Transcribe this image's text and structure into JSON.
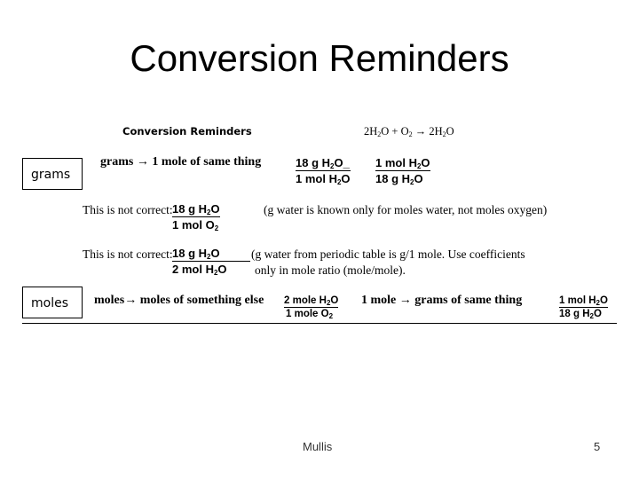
{
  "slide": {
    "title": "Conversion Reminders",
    "footer_author": "Mullis",
    "page_number": "5"
  },
  "content": {
    "heading": "Conversion Reminders",
    "equation": {
      "left_coef": "2H",
      "left_sub": "2",
      "left_rest": "O + O",
      "o2_sub": "2",
      "arrow": "→",
      "right_coef": "2H",
      "right_sub": "2",
      "right_rest": "O"
    },
    "grams_box": "grams",
    "grams_rule": "grams → 1 mole of same thing",
    "grams_frac1": {
      "num_a": "18 g H",
      "num_sub": "2",
      "num_b": "O_",
      "den_a": "1 mol H",
      "den_sub": "2",
      "den_b": "O"
    },
    "grams_frac2": {
      "num_a": "1 mol H",
      "num_sub": "2",
      "num_b": "O",
      "den_a": "18 g H",
      "den_sub": "2",
      "den_b": "O"
    },
    "incorrect1": {
      "label": "This is not correct:",
      "num_a": "18 g H",
      "num_sub": "2",
      "num_b": "O",
      "den_a": "1 mol O",
      "den_sub": "2",
      "den_b": "",
      "note": "(g water is known only for moles water, not moles oxygen)"
    },
    "incorrect2": {
      "label": "This is not correct:",
      "num_a": "18 g H",
      "num_sub": "2",
      "num_b": "O",
      "den_a": "2 mol H",
      "den_sub": "2",
      "den_b": "O",
      "note_line1": "(g water from periodic table is g/1 mole.  Use coefficients",
      "note_line2": "only in mole ratio (mole/mole)."
    },
    "moles_box": "moles",
    "moles_rule": "moles→ moles of something else",
    "moles_frac": {
      "num_a": "2 mole H",
      "num_sub": "2",
      "num_b": "O",
      "den_a": "1 mole O",
      "den_sub": "2",
      "den_b": ""
    },
    "mole_grams_rule": "1 mole → grams of same thing",
    "mole_grams_frac": {
      "num_a": "1 mol H",
      "num_sub": "2",
      "num_b": "O",
      "den_a": "18 g H",
      "den_sub": "2",
      "den_b": "O"
    }
  }
}
